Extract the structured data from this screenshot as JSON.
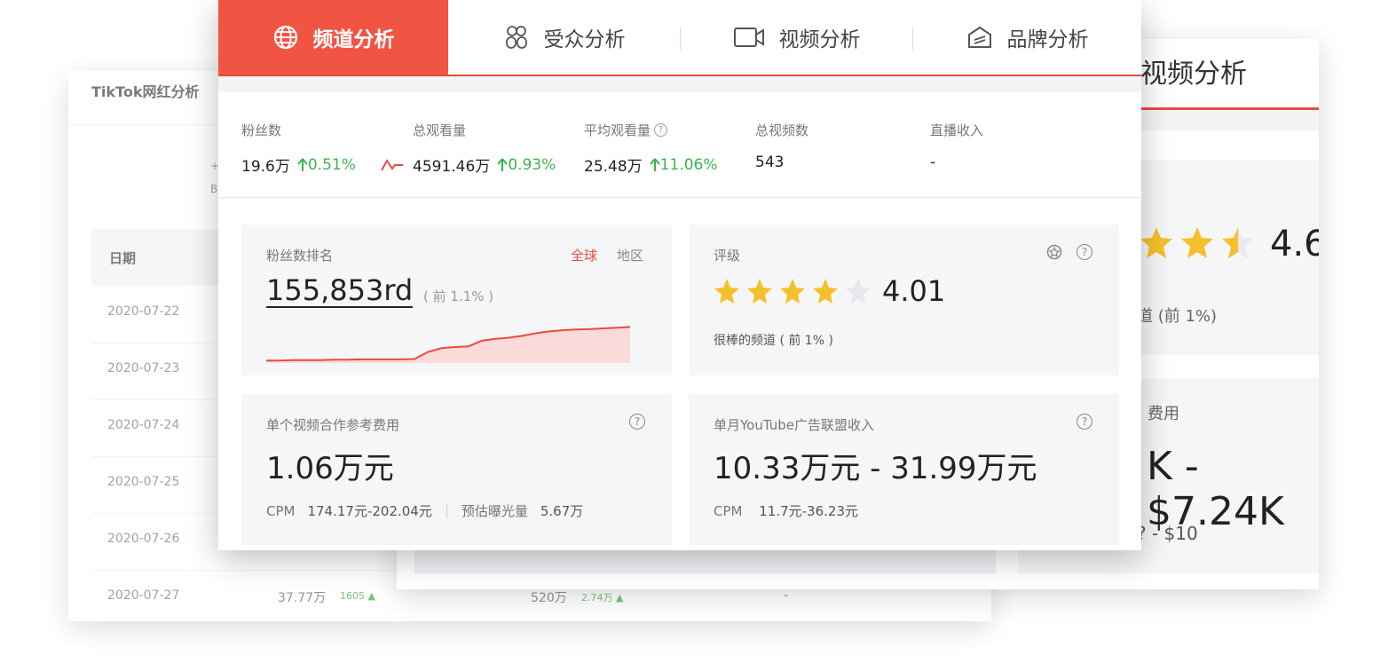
{
  "accent": "#f25444",
  "up_color": "#3bb54a",
  "left_card": {
    "title": "TikTok网红分析",
    "blips": [
      "+",
      "B"
    ],
    "header_date": "日期",
    "rows": [
      {
        "date": "2020-07-22",
        "v1": "",
        "d1": "",
        "v2": "",
        "d2": "",
        "v3": ""
      },
      {
        "date": "2020-07-23",
        "v1": "",
        "d1": "",
        "v2": "",
        "d2": "",
        "v3": ""
      },
      {
        "date": "2020-07-24",
        "v1": "",
        "d1": "",
        "v2": "",
        "d2": "",
        "v3": ""
      },
      {
        "date": "2020-07-25",
        "v1": "",
        "d1": "",
        "v2": "",
        "d2": "",
        "v3": ""
      },
      {
        "date": "2020-07-26",
        "v1": "",
        "d1": "",
        "v2": "",
        "d2": "",
        "v3": ""
      },
      {
        "date": "2020-07-27",
        "v1": "37.77万",
        "d1": "1605",
        "v2": "520万",
        "d2": "2.74万",
        "v3": "-"
      }
    ]
  },
  "right_card": {
    "tab_title": "视频分析",
    "rating": "4.6",
    "rating_note": "道 (前 1%)",
    "fee_label": "费用",
    "fee_value": "K - $7.24K",
    "fee_sub": "? - $10"
  },
  "tabs": [
    {
      "label": "频道分析",
      "icon": "globe-icon",
      "active": true
    },
    {
      "label": "受众分析",
      "icon": "audience-icon",
      "active": false
    },
    {
      "label": "视频分析",
      "icon": "video-camera-icon",
      "active": false
    },
    {
      "label": "品牌分析",
      "icon": "brand-icon",
      "active": false
    }
  ],
  "metrics": {
    "fans": {
      "label": "粉丝数",
      "value": "19.6万",
      "delta": "0.51%"
    },
    "views": {
      "label": "总观看量",
      "value": "4591.46万",
      "delta": "0.93%"
    },
    "avg_views": {
      "label": "平均观看量",
      "value": "25.48万",
      "delta": "11.06%"
    },
    "videos": {
      "label": "总视频数",
      "value": "543"
    },
    "live": {
      "label": "直播收入",
      "value": "-"
    }
  },
  "rank": {
    "label": "粉丝数排名",
    "scope_global": "全球",
    "scope_region": "地区",
    "value": "155,853rd",
    "note": "( 前 1.1% )",
    "trend": [
      0.02,
      0.02,
      0.03,
      0.03,
      0.03,
      0.04,
      0.04,
      0.05,
      0.05,
      0.05,
      0.05,
      0.06,
      0.25,
      0.35,
      0.38,
      0.4,
      0.55,
      0.6,
      0.63,
      0.68,
      0.75,
      0.8,
      0.83,
      0.85,
      0.86,
      0.88,
      0.9,
      0.92
    ]
  },
  "rating": {
    "label": "评级",
    "score": "4.01",
    "stars_value": 4.01,
    "note": "很棒的频道 ( 前 1% )"
  },
  "fee": {
    "label": "单个视频合作参考费用",
    "value": "1.06万元",
    "cpm_label": "CPM",
    "cpm_value": "174.17元-202.04元",
    "exposure_label": "预估曝光量",
    "exposure_value": "5.67万"
  },
  "youtube": {
    "label": "单月YouTube广告联盟收入",
    "value": "10.33万元 - 31.99万元",
    "cpm_label": "CPM",
    "cpm_value": "11.7元-36.23元"
  }
}
